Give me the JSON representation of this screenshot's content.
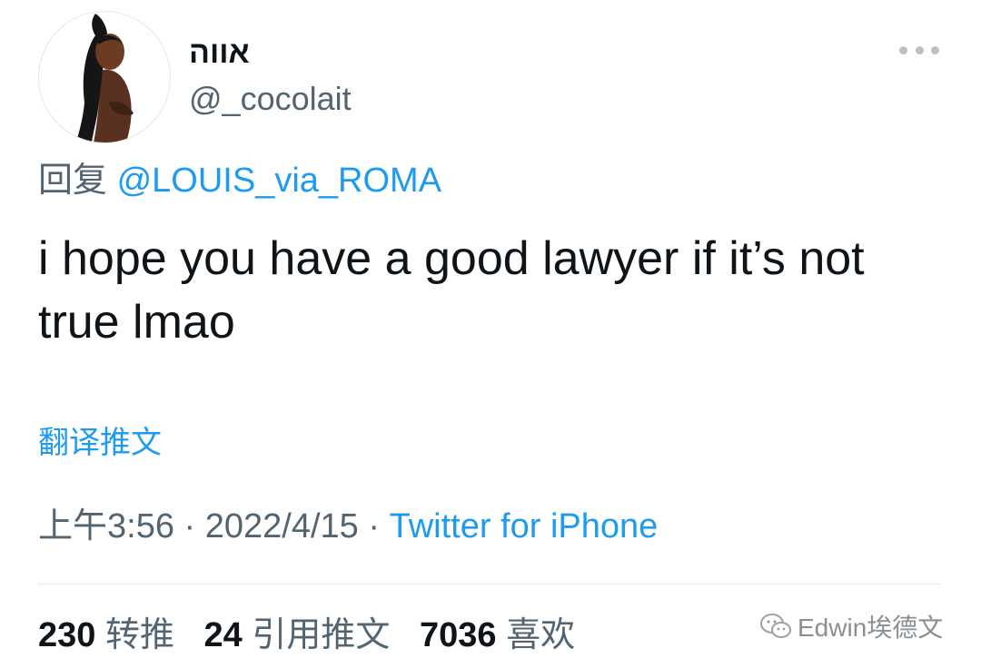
{
  "user": {
    "display_name": "אווה",
    "handle": "@_cocolait",
    "avatar_icon": "avatar-illustration"
  },
  "reply": {
    "prefix": "回复",
    "mention": "@LOUIS_via_ROMA"
  },
  "tweet": {
    "text": "i hope you have a good lawyer if it’s not true lmao"
  },
  "translate_label": "翻译推文",
  "meta": {
    "time": "上午3:56",
    "sep1": "·",
    "date": "2022/4/15",
    "sep2": "·",
    "source": "Twitter for iPhone"
  },
  "stats": {
    "retweets": {
      "count": "230",
      "label": "转推"
    },
    "quotes": {
      "count": "24",
      "label": "引用推文"
    },
    "likes": {
      "count": "7036",
      "label": "喜欢"
    }
  },
  "watermark": {
    "text": "Edwin埃德文",
    "icon": "wechat-icon"
  },
  "colors": {
    "link": "#1d9bf0",
    "secondary": "#536471",
    "primary": "#0f1419"
  }
}
